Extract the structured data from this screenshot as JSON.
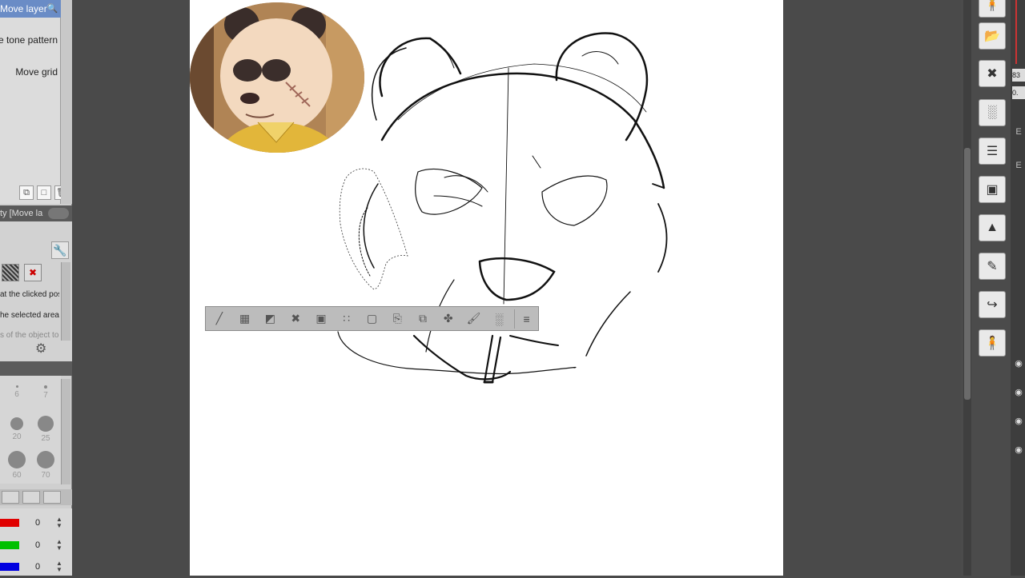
{
  "left_panel": {
    "tool_rows": [
      {
        "label": "Move layer",
        "selected": true
      },
      {
        "label": "e tone pattern",
        "selected": false
      },
      {
        "label": "Move grid",
        "selected": false
      }
    ],
    "property_header": "ty [Move la",
    "property_texts": [
      {
        "text": "at the clicked pos",
        "dim": false
      },
      {
        "text": "he selected area",
        "dim": false
      },
      {
        "text": "s of the object to",
        "dim": true
      }
    ],
    "brush_sizes": [
      "6",
      "7",
      "20",
      "25",
      "60",
      "70"
    ],
    "color_values": [
      {
        "color": "#e00000",
        "value": "0"
      },
      {
        "color": "#00c000",
        "value": "0"
      },
      {
        "color": "#0000e0",
        "value": "0"
      }
    ]
  },
  "right_panel": {
    "tool_buttons": [
      "move-layer-icon",
      "flip-icon",
      "tone-icon",
      "layer-list-icon",
      "3d-icon",
      "image-icon",
      "edit-icon",
      "import-icon",
      "figure-icon"
    ],
    "side_values": [
      "83",
      "0."
    ],
    "side_letters": [
      "E",
      "E"
    ]
  },
  "float_toolbar": {
    "icons": [
      "transform-icon",
      "select-rect-icon",
      "fill-half-icon",
      "expand-icon",
      "shrink-icon",
      "dots-icon",
      "selection-frame-icon",
      "copy-icon",
      "paste-icon",
      "scale-icon",
      "bucket-icon",
      "pattern-icon"
    ],
    "grip": "grip-icon"
  }
}
